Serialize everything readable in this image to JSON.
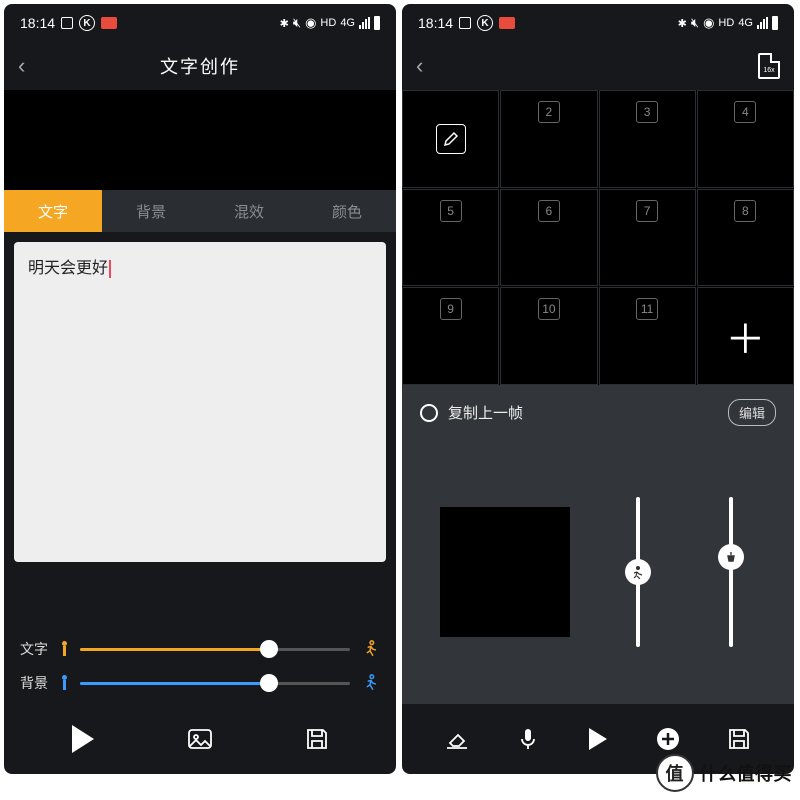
{
  "statusbar": {
    "time": "18:14",
    "hd": "HD",
    "net": "4G"
  },
  "left": {
    "title": "文字创作",
    "tabs": [
      "文字",
      "背景",
      "混效",
      "颜色"
    ],
    "active_tab": 0,
    "editor_text": "明天会更好",
    "sliders": {
      "text": {
        "label": "文字",
        "value_pct": 70,
        "color": "#f5a623"
      },
      "bg": {
        "label": "背景",
        "value_pct": 70,
        "color": "#3b9bff"
      }
    }
  },
  "right": {
    "file_label": "16x",
    "grid_numbers": [
      null,
      "2",
      "3",
      "4",
      "5",
      "6",
      "7",
      "8",
      "9",
      "10",
      "11",
      "+"
    ],
    "copy_label": "复制上一帧",
    "edit_label": "编辑",
    "vslider1_pct": 50,
    "vslider2_pct": 40
  },
  "watermark": {
    "badge": "值",
    "text": "什么值得买"
  }
}
